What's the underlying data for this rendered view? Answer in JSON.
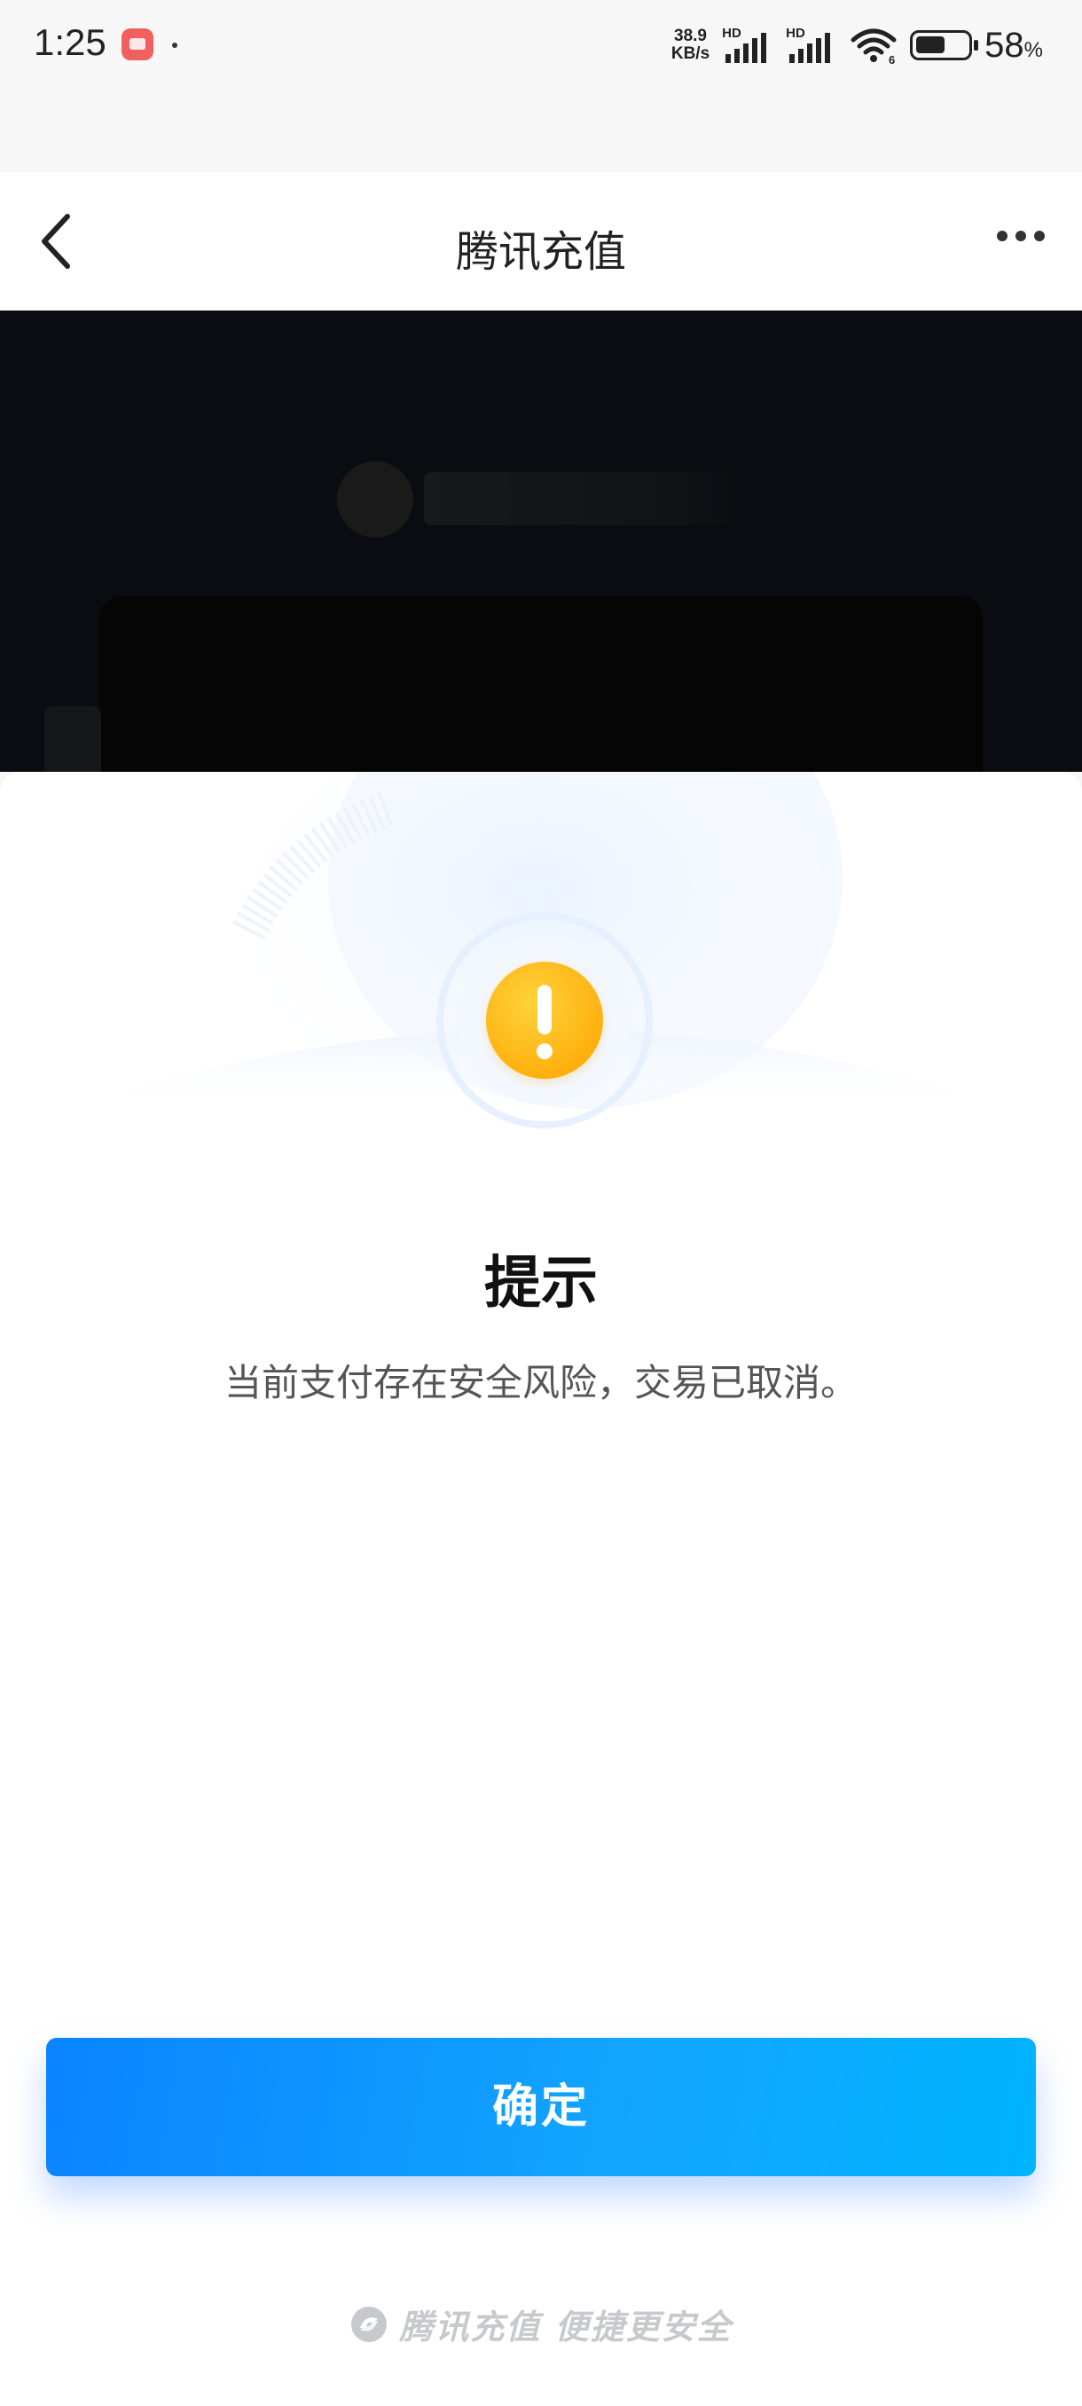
{
  "status_bar": {
    "time": "1:25",
    "net_speed_value": "38.9",
    "net_speed_unit": "KB/s",
    "sim1_label": "HD",
    "sim2_label": "HD",
    "wifi_badge": "6",
    "battery_percent": "58",
    "battery_symbol": "%",
    "battery_level": 0.58
  },
  "nav": {
    "title": "腾讯充值"
  },
  "dialog": {
    "title": "提示",
    "message": "当前支付存在安全风险，交易已取消。",
    "confirm_label": "确定",
    "icon": "warning-icon",
    "accent_color": "#0a84ff",
    "warning_color": "#ffae0c"
  },
  "footer": {
    "brand_text": "腾讯充值 便捷更安全"
  }
}
